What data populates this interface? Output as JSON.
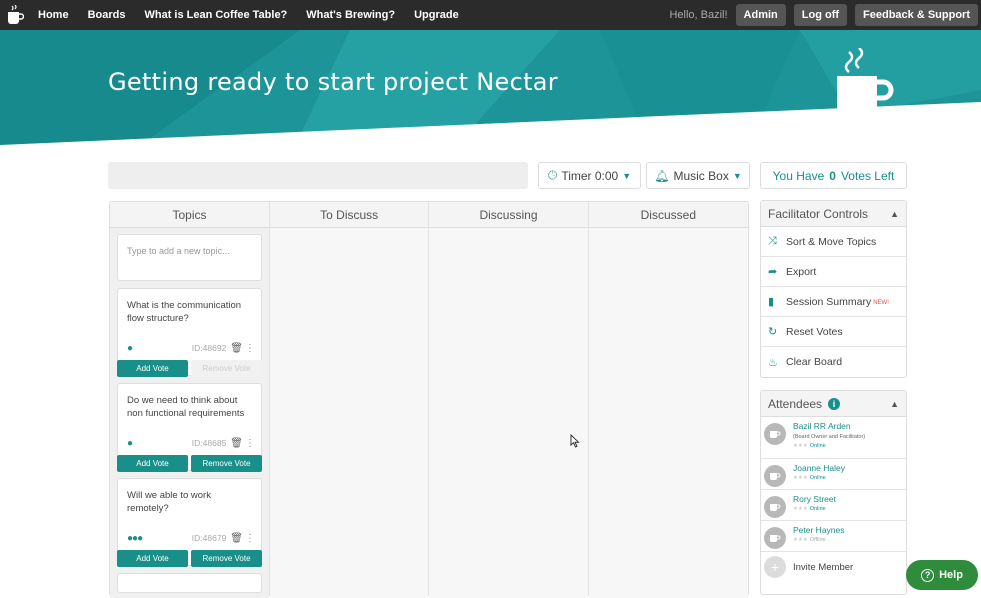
{
  "nav": {
    "links": [
      "Home",
      "Boards",
      "What is Lean Coffee Table?",
      "What's Brewing?",
      "Upgrade"
    ],
    "greeting": "Hello, Bazil!",
    "admin_label": "Admin",
    "logoff_label": "Log off",
    "feedback_label": "Feedback & Support",
    "logo_icon": "coffee-cup-icon"
  },
  "hero": {
    "title": "Getting ready to start project Nectar",
    "colors": {
      "teal_dark": "#178a8d",
      "teal_light": "#2aa7a8"
    }
  },
  "toolbar": {
    "timer_label": "Timer 0:00",
    "music_label": "Music Box",
    "votes_prefix": "You Have",
    "votes_count": "0",
    "votes_suffix": "Votes Left"
  },
  "board": {
    "columns": [
      "Topics",
      "To Discuss",
      "Discussing",
      "Discussed"
    ],
    "new_topic_placeholder": "Type to add a new topic...",
    "cards": [
      {
        "text": "What is the communication flow structure?",
        "id": "ID:48692",
        "dots": "●",
        "add": "Add Vote",
        "remove": "Remove Vote",
        "remove_disabled": true
      },
      {
        "text": "Do we need to think about non functional requirements",
        "id": "ID:48685",
        "dots": "●",
        "add": "Add Vote",
        "remove": "Remove Vote",
        "remove_disabled": false
      },
      {
        "text": "Will we able to work remotely?",
        "id": "ID:48679",
        "dots": "●●●",
        "add": "Add Vote",
        "remove": "Remove Vote",
        "remove_disabled": false
      }
    ]
  },
  "facilitator": {
    "title": "Facilitator Controls",
    "items": [
      {
        "label": "Sort & Move Topics",
        "icon": "shuffle-icon"
      },
      {
        "label": "Export",
        "icon": "share-arrow-icon"
      },
      {
        "label": "Session Summary",
        "icon": "document-icon",
        "badge": "NEW!"
      },
      {
        "label": "Reset Votes",
        "icon": "refresh-icon"
      },
      {
        "label": "Clear Board",
        "icon": "fire-icon"
      }
    ]
  },
  "attendees": {
    "title": "Attendees",
    "people": [
      {
        "name": "Bazil RR Arden",
        "role": "(Board Owner and Facilitator)",
        "status": "Online"
      },
      {
        "name": "Joanne Haley",
        "role": "",
        "status": "Online"
      },
      {
        "name": "Rory Street",
        "role": "",
        "status": "Online"
      },
      {
        "name": "Peter Haynes",
        "role": "",
        "status": "Offline"
      }
    ],
    "invite_label": "Invite Member"
  },
  "help": {
    "label": "Help"
  }
}
